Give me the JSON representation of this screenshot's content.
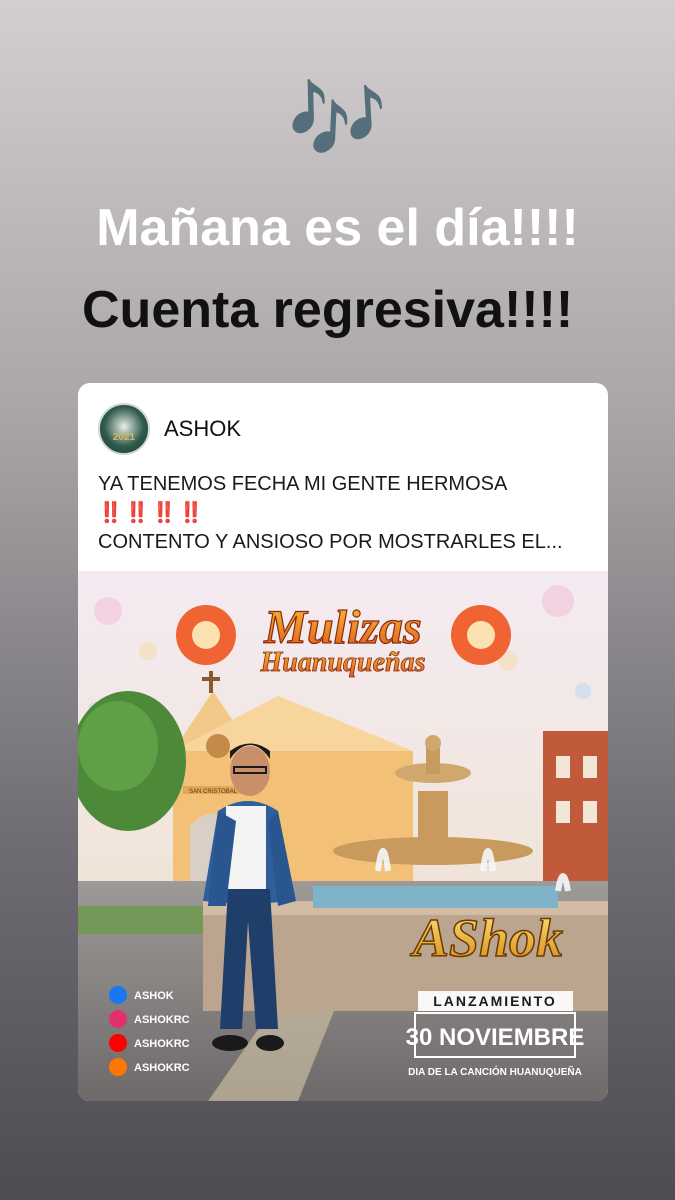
{
  "story": {
    "notes_emoji": "🎶",
    "headline_line1": "Mañana es el día!!!!",
    "headline_line2": "Cuenta regresiva!!!!"
  },
  "post": {
    "account_name": "ASHOK",
    "avatar_text": "2021",
    "caption_line1": "YA TENEMOS FECHA MI GENTE HERMOSA",
    "caption_marks": "‼️‼️‼️‼️",
    "caption_line2": "CONTENTO Y ANSIOSO POR MOSTRARLES EL..."
  },
  "poster": {
    "title_line1": "Mulizas",
    "title_line2": "Huanuqueñas",
    "church_sign": "SAN CRISTOBAL",
    "artist_logo": "AShok",
    "launch_label": "LANZAMIENTO",
    "launch_date": "30 NOVIEMBRE",
    "launch_sub": "DIA DE LA CANCIÓN HUANUQUEÑA",
    "social": [
      {
        "network": "facebook",
        "handle": "ASHOK",
        "color": "#1877f2"
      },
      {
        "network": "instagram",
        "handle": "ASHOKRC",
        "color": "#e1306c"
      },
      {
        "network": "youtube",
        "handle": "ASHOKRC",
        "color": "#ff0000"
      },
      {
        "network": "soundcloud",
        "handle": "ASHOKRC",
        "color": "#ff7700"
      }
    ]
  }
}
